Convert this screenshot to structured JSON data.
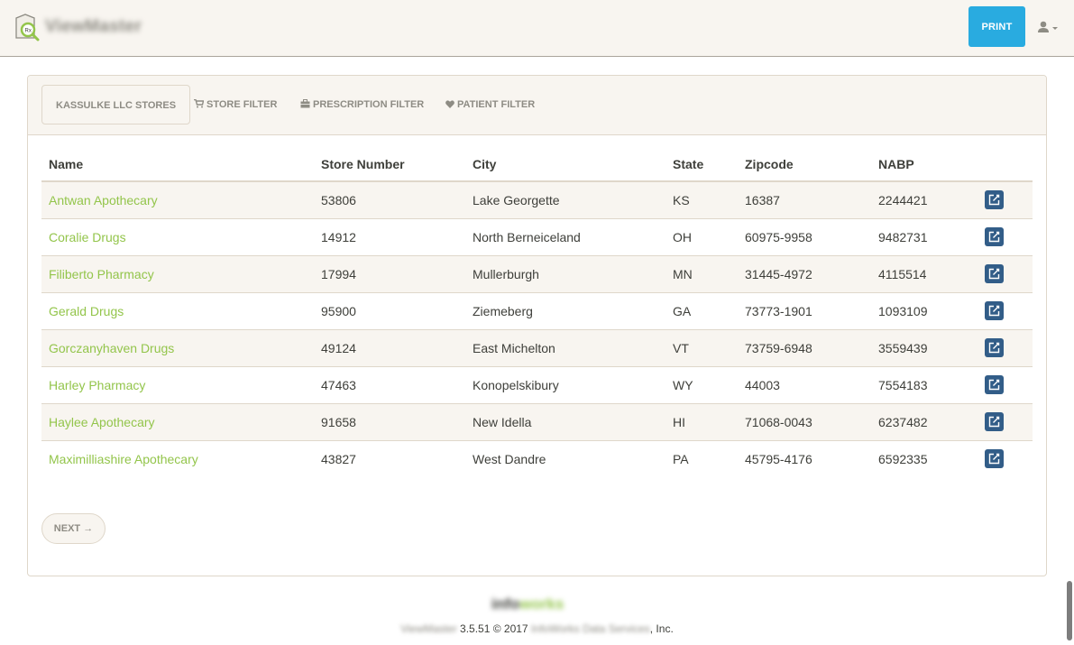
{
  "app": {
    "name": "ViewMaster"
  },
  "toolbar": {
    "print_label": "PRINT"
  },
  "tabs": [
    {
      "label": "KASSULKE LLC STORES",
      "icon": ""
    },
    {
      "label": "STORE FILTER",
      "icon": "cart-icon"
    },
    {
      "label": "PRESCRIPTION FILTER",
      "icon": "briefcase-icon"
    },
    {
      "label": "PATIENT FILTER",
      "icon": "heart-icon"
    }
  ],
  "table": {
    "columns": [
      "Name",
      "Store Number",
      "City",
      "State",
      "Zipcode",
      "NABP"
    ],
    "rows": [
      {
        "name": "Antwan Apothecary",
        "store_number": "53806",
        "city": "Lake Georgette",
        "state": "KS",
        "zipcode": "16387",
        "nabp": "2244421"
      },
      {
        "name": "Coralie Drugs",
        "store_number": "14912",
        "city": "North Berneiceland",
        "state": "OH",
        "zipcode": "60975-9958",
        "nabp": "9482731"
      },
      {
        "name": "Filiberto Pharmacy",
        "store_number": "17994",
        "city": "Mullerburgh",
        "state": "MN",
        "zipcode": "31445-4972",
        "nabp": "4115514"
      },
      {
        "name": "Gerald Drugs",
        "store_number": "95900",
        "city": "Ziemeberg",
        "state": "GA",
        "zipcode": "73773-1901",
        "nabp": "1093109"
      },
      {
        "name": "Gorczanyhaven Drugs",
        "store_number": "49124",
        "city": "East Michelton",
        "state": "VT",
        "zipcode": "73759-6948",
        "nabp": "3559439"
      },
      {
        "name": "Harley Pharmacy",
        "store_number": "47463",
        "city": "Konopelskibury",
        "state": "WY",
        "zipcode": "44003",
        "nabp": "7554183"
      },
      {
        "name": "Haylee Apothecary",
        "store_number": "91658",
        "city": "New Idella",
        "state": "HI",
        "zipcode": "71068-0043",
        "nabp": "6237482"
      },
      {
        "name": "Maximilliashire Apothecary",
        "store_number": "43827",
        "city": "West Dandre",
        "state": "PA",
        "zipcode": "45795-4176",
        "nabp": "6592335"
      }
    ]
  },
  "pagination": {
    "next_label": "NEXT →"
  },
  "footer": {
    "logo_part1": "info",
    "logo_part2": "works",
    "product": "ViewMaster",
    "version_text": " 3.5.51 © 2017 ",
    "company": "InfoWorks Data Services",
    "suffix": ", Inc."
  },
  "colors": {
    "accent": "#93c54b",
    "primary": "#29abe0",
    "edit": "#325d88",
    "panel_bg": "#f8f5f0"
  }
}
